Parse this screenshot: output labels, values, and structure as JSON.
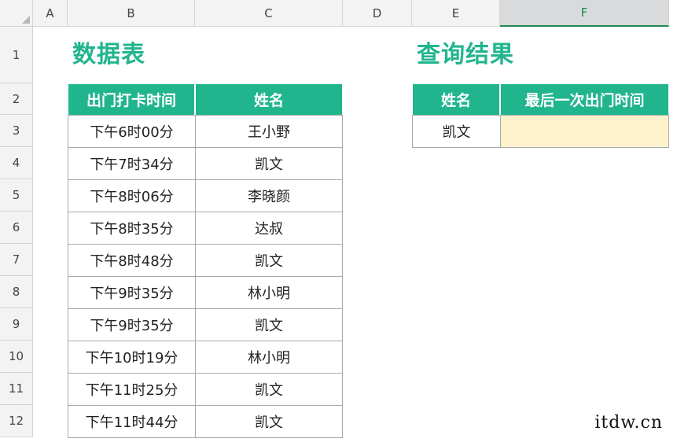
{
  "grid": {
    "columns": [
      "A",
      "B",
      "C",
      "D",
      "E",
      "F"
    ],
    "selected_column": "F",
    "rows": [
      "1",
      "2",
      "3",
      "4",
      "5",
      "6",
      "7",
      "8",
      "9",
      "10",
      "11",
      "12"
    ]
  },
  "left_section": {
    "title": "数据表",
    "headers": [
      "出门打卡时间",
      "姓名"
    ],
    "records": [
      [
        "下午6时00分",
        "王小野"
      ],
      [
        "下午7时34分",
        "凯文"
      ],
      [
        "下午8时06分",
        "李晓颜"
      ],
      [
        "下午8时35分",
        "达叔"
      ],
      [
        "下午8时48分",
        "凯文"
      ],
      [
        "下午9时35分",
        "林小明"
      ],
      [
        "下午9时35分",
        "凯文"
      ],
      [
        "下午10时19分",
        "林小明"
      ],
      [
        "下午11时25分",
        "凯文"
      ],
      [
        "下午11时44分",
        "凯文"
      ]
    ]
  },
  "right_section": {
    "title": "查询结果",
    "headers": [
      "姓名",
      "最后一次出门时间"
    ],
    "query_name": "凯文",
    "query_result": ""
  },
  "watermark": "itdw.cn",
  "colors": {
    "accent": "#21b58e",
    "result_fill": "#fef2cc",
    "selected_column": "#1f8a53"
  }
}
